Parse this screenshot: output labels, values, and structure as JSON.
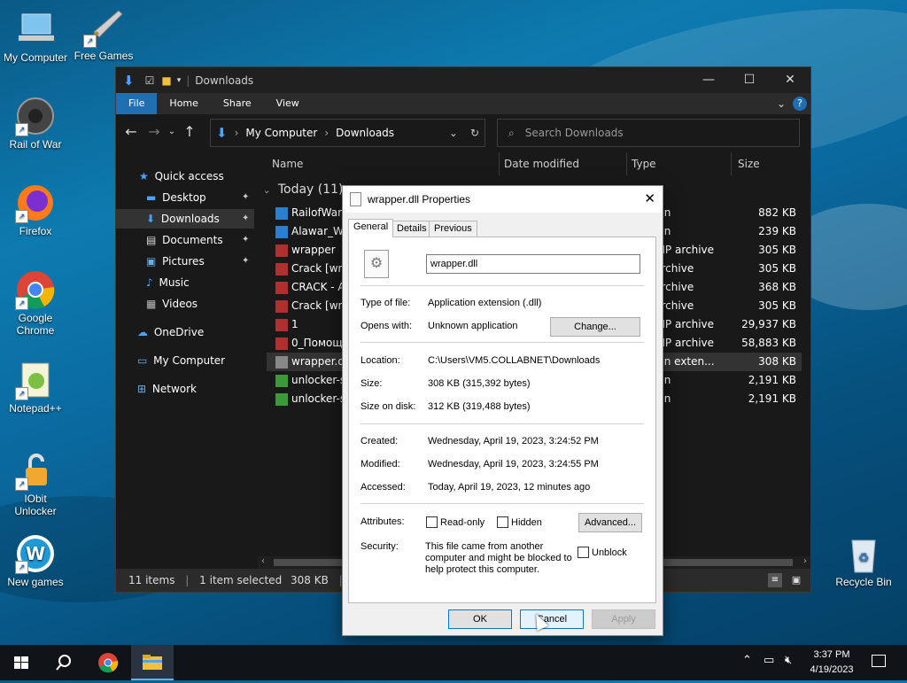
{
  "colors": {
    "accent": "#1f6fb2",
    "window_bg": "#191919",
    "dialog_bg": "#f0f0f0"
  },
  "desktop": {
    "icons": [
      {
        "label": "My Computer",
        "icon": "computer-icon"
      },
      {
        "label": "Free Games",
        "icon": "sword-icon"
      },
      {
        "label": "Rail of War",
        "icon": "game-icon"
      },
      {
        "label": "Firefox",
        "icon": "firefox-icon"
      },
      {
        "label": "Google Chrome",
        "icon": "chrome-icon"
      },
      {
        "label": "Notepad++",
        "icon": "notepad-icon"
      },
      {
        "label": "IObit Unlocker",
        "icon": "lock-icon"
      },
      {
        "label": "New games",
        "icon": "w-icon"
      },
      {
        "label": "Recycle Bin",
        "icon": "recycle-bin-icon"
      }
    ]
  },
  "explorer": {
    "title": "Downloads",
    "ribbon_tabs": [
      "File",
      "Home",
      "Share",
      "View"
    ],
    "breadcrumb": [
      "My Computer",
      "Downloads"
    ],
    "search_placeholder": "Search Downloads",
    "nav": [
      {
        "label": "Quick access"
      },
      {
        "label": "Desktop"
      },
      {
        "label": "Downloads"
      },
      {
        "label": "Documents"
      },
      {
        "label": "Pictures"
      },
      {
        "label": "Music"
      },
      {
        "label": "Videos"
      },
      {
        "label": "OneDrive"
      },
      {
        "label": "My Computer"
      },
      {
        "label": "Network"
      }
    ],
    "columns": [
      "Name",
      "Date modified",
      "Type",
      "Size"
    ],
    "group": "Today (11)",
    "files": [
      {
        "name": "RailofWar_",
        "type": "ation",
        "size": "882 KB"
      },
      {
        "name": "Alawar_Wr",
        "type": "ation",
        "size": "239 KB"
      },
      {
        "name": "wrapper",
        "type": "R ZIP archive",
        "size": "305 KB"
      },
      {
        "name": "Crack [wra",
        "type": "R archive",
        "size": "305 KB"
      },
      {
        "name": "CRACK - A",
        "type": "R archive",
        "size": "368 KB"
      },
      {
        "name": "Crack [wra",
        "type": "R archive",
        "size": "305 KB"
      },
      {
        "name": "1",
        "type": "R ZIP archive",
        "size": "29,937 KB"
      },
      {
        "name": "0_Помощь",
        "type": "R ZIP archive",
        "size": "58,883 KB"
      },
      {
        "name": "wrapper.dll",
        "type": "ation exten...",
        "size": "308 KB"
      },
      {
        "name": "unlocker-s",
        "type": "ation",
        "size": "2,191 KB"
      },
      {
        "name": "unlocker-s",
        "type": "ation",
        "size": "2,191 KB"
      }
    ],
    "status": {
      "items": "11 items",
      "selected": "1 item selected",
      "size": "308 KB"
    }
  },
  "dialog": {
    "title": "wrapper.dll Properties",
    "tabs": [
      "General",
      "Details",
      "Previous Versions"
    ],
    "filename": "wrapper.dll",
    "type_label": "Type of file:",
    "type_value": "Application extension (.dll)",
    "opens_label": "Opens with:",
    "opens_value": "Unknown application",
    "change_btn": "Change...",
    "location_label": "Location:",
    "location_value": "C:\\Users\\VM5.COLLABNET\\Downloads",
    "size_label": "Size:",
    "size_value": "308 KB (315,392 bytes)",
    "disk_label": "Size on disk:",
    "disk_value": "312 KB (319,488 bytes)",
    "created_label": "Created:",
    "created_value": "Wednesday, April 19, 2023, 3:24:52 PM",
    "modified_label": "Modified:",
    "modified_value": "Wednesday, April 19, 2023, 3:24:55 PM",
    "accessed_label": "Accessed:",
    "accessed_value": "Today, April 19, 2023, 12 minutes ago",
    "attr_label": "Attributes:",
    "readonly": "Read-only",
    "hidden": "Hidden",
    "advanced_btn": "Advanced...",
    "security_label": "Security:",
    "security_line1": "This file came from another",
    "security_line2": "computer and might be blocked to",
    "security_line3": "help protect this computer.",
    "unblock": "Unblock",
    "ok": "OK",
    "cancel": "Cancel",
    "apply": "Apply"
  },
  "taskbar": {
    "time": "3:37 PM",
    "date": "4/19/2023"
  }
}
